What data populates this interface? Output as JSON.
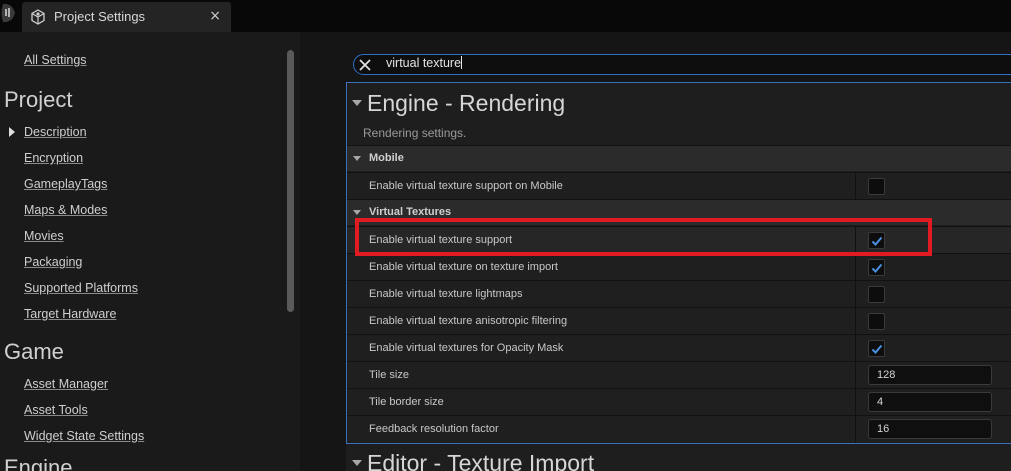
{
  "titlebar": {
    "tab_title": "Project Settings",
    "close_glyph": "×"
  },
  "sidebar": {
    "all_settings": "All Settings",
    "project_heading": "Project",
    "project_items": [
      "Description",
      "Encryption",
      "GameplayTags",
      "Maps & Modes",
      "Movies",
      "Packaging",
      "Supported Platforms",
      "Target Hardware"
    ],
    "game_heading": "Game",
    "game_items": [
      "Asset Manager",
      "Asset Tools",
      "Widget State Settings"
    ],
    "engine_heading": "Engine"
  },
  "search": {
    "value": "virtual texture"
  },
  "section": {
    "title": "Engine - Rendering",
    "description": "Rendering settings.",
    "categories": {
      "mobile": "Mobile",
      "virtual_textures": "Virtual Textures"
    },
    "rows": [
      {
        "label": "Enable virtual texture support on Mobile",
        "type": "checkbox",
        "checked": false
      },
      {
        "label": "Enable virtual texture support",
        "type": "checkbox",
        "checked": true
      },
      {
        "label": "Enable virtual texture on texture import",
        "type": "checkbox",
        "checked": true
      },
      {
        "label": "Enable virtual texture lightmaps",
        "type": "checkbox",
        "checked": false
      },
      {
        "label": "Enable virtual texture anisotropic filtering",
        "type": "checkbox",
        "checked": false
      },
      {
        "label": "Enable virtual textures for Opacity Mask",
        "type": "checkbox",
        "checked": true
      },
      {
        "label": "Tile size",
        "type": "number",
        "value": "128"
      },
      {
        "label": "Tile border size",
        "type": "number",
        "value": "4"
      },
      {
        "label": "Feedback resolution factor",
        "type": "number",
        "value": "16"
      }
    ]
  },
  "next_section": {
    "title": "Editor - Texture Import"
  },
  "colors": {
    "accent_blue": "#2f6fc8",
    "highlight_red": "#e01b22",
    "check_blue": "#4a90e2"
  }
}
